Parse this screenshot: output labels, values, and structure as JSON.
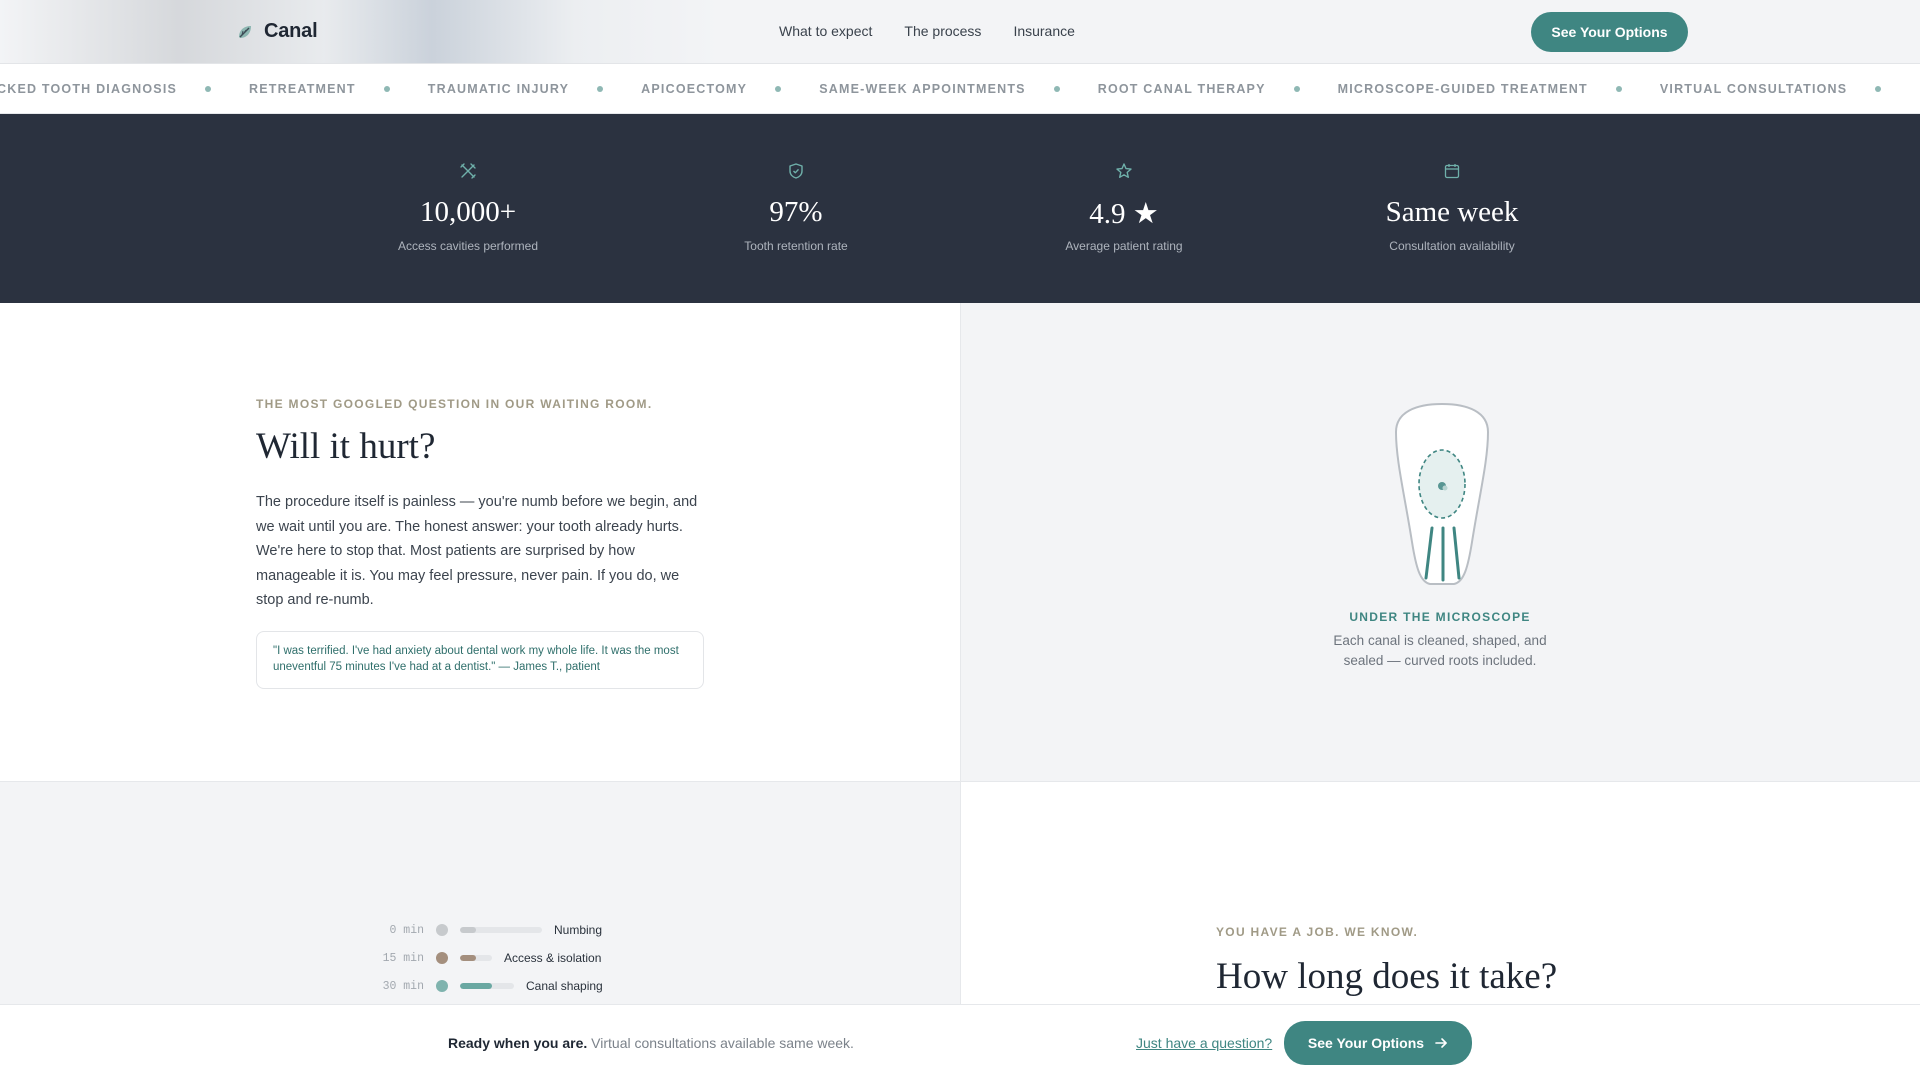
{
  "header": {
    "logo_text": "Canal",
    "logo_icon": "tooth-leaf-icon",
    "nav": [
      "What to expect",
      "The process",
      "Insurance"
    ],
    "cta_label": "See Your Options"
  },
  "ticker": {
    "items": [
      "CKED TOOTH DIAGNOSIS",
      "RETREATMENT",
      "TRAUMATIC INJURY",
      "APICOECTOMY",
      "SAME-WEEK APPOINTMENTS",
      "ROOT CANAL THERAPY",
      "MICROSCOPE-GUIDED TREATMENT",
      "VIRTUAL CONSULTATIONS"
    ]
  },
  "stats": [
    {
      "icon": "tools-icon",
      "value": "10,000+",
      "label": "Access cavities performed"
    },
    {
      "icon": "shield-icon",
      "value": "97%",
      "label": "Tooth retention rate"
    },
    {
      "icon": "star-icon",
      "value": "4.9 ★",
      "label": "Average patient rating"
    },
    {
      "icon": "calendar-icon",
      "value": "Same week",
      "label": "Consultation availability"
    }
  ],
  "hurt": {
    "eyebrow": "THE MOST GOOGLED QUESTION IN OUR WAITING ROOM.",
    "title": "Will it hurt?",
    "body": "The procedure itself is painless — you're numb before we begin, and we wait until you are. The honest answer: your tooth already hurts. We're here to stop that. Most patients are surprised by how manageable it is. You may feel pressure, never pain. If you do, we stop and re-numb.",
    "quote": "\"I was terrified. I've had anxiety about dental work my whole life. It was the most uneventful 75 minutes I've had at a dentist.\" — James T., patient"
  },
  "microscope": {
    "title": "UNDER THE MICROSCOPE",
    "body": "Each canal is cleaned, shaped, and sealed — curved roots included."
  },
  "timeline": [
    {
      "minute": "0 min",
      "label": "Numbing",
      "dot_color": "#c7cacd",
      "fill_color": "#c7cacd",
      "fill_fraction": 0.2
    },
    {
      "minute": "15 min",
      "label": "Access & isolation",
      "dot_color": "#a48f7e",
      "fill_color": "#a48f7e",
      "fill_fraction": 0.5
    },
    {
      "minute": "30 min",
      "label": "Canal shaping",
      "dot_color": "#7fb3ae",
      "fill_color": "#6aa8a2",
      "fill_fraction": 0.6
    }
  ],
  "duration": {
    "eyebrow": "YOU HAVE A JOB. WE KNOW.",
    "title": "How long does it take?"
  },
  "sticky": {
    "lead": "Ready when you are.",
    "text": "Virtual consultations available same week.",
    "link": "Just have a question?",
    "cta_label": "See Your Options",
    "cta_icon": "arrow-right-icon"
  },
  "colors": {
    "accent": "#3f8682",
    "dark": "#2b3240"
  }
}
